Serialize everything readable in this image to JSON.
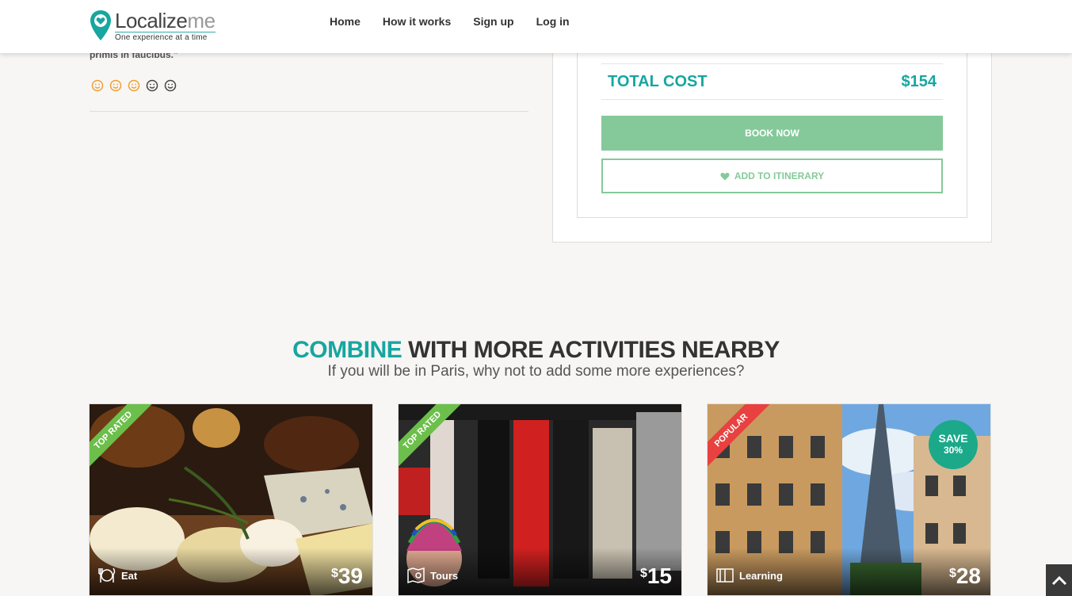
{
  "header": {
    "logo_name": "Localize",
    "logo_name_suffix": "me",
    "logo_tagline": "One experience at a time",
    "nav": [
      "Home",
      "How it works",
      "Sign up",
      "Log in"
    ]
  },
  "review": {
    "tail_text": "primis in faucibus.\"",
    "rating": 3,
    "rating_max": 5
  },
  "booking": {
    "total_label": "TOTAL COST",
    "total_value": "$154",
    "book_label": "BOOK NOW",
    "itinerary_label": "ADD TO ITINERARY"
  },
  "section": {
    "title_accent": "COMBINE",
    "title_rest": " WITH MORE ACTIVITIES NEARBY",
    "subtitle": "If you will be in Paris, why not to add some more experiences?"
  },
  "cards": [
    {
      "ribbon": "TOP RATED",
      "category": "Eat",
      "currency": "$",
      "price": "39"
    },
    {
      "ribbon": "TOP RATED",
      "category": "Tours",
      "currency": "$",
      "price": "15"
    },
    {
      "ribbon": "POPULAR",
      "category": "Learning",
      "currency": "$",
      "price": "28",
      "badge_line1": "SAVE",
      "badge_line2": "30%"
    }
  ],
  "colors": {
    "accent": "#17a6a0",
    "button_green": "#85c99a",
    "ribbon_green": "#6cbf4a",
    "ribbon_red": "#e8413f",
    "badge": "#1ba98a"
  }
}
